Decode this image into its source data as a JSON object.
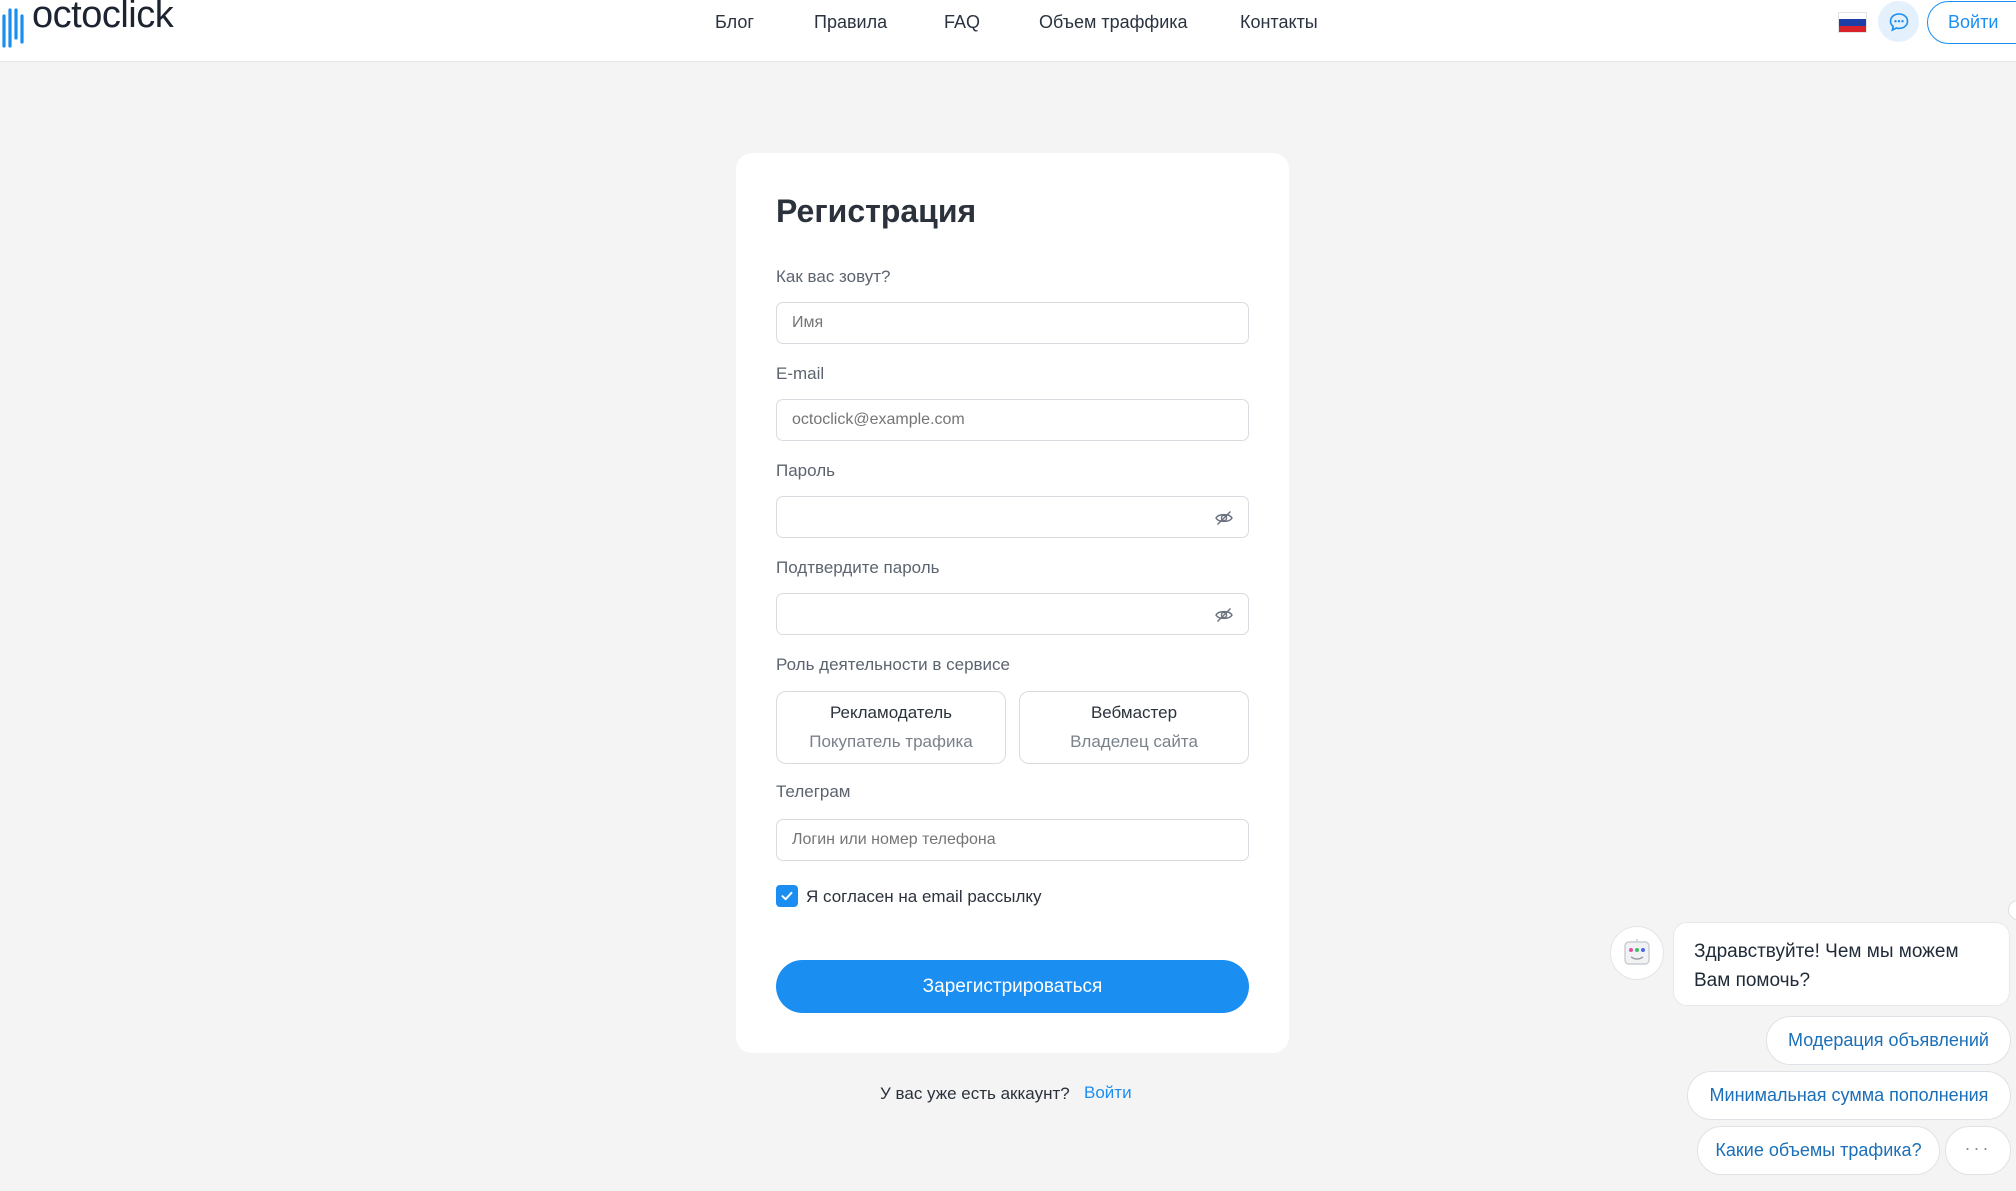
{
  "header": {
    "logo_text": "octoclick",
    "nav": [
      "Блог",
      "Правила",
      "FAQ",
      "Объем траффика",
      "Контакты"
    ],
    "login_label": "Войти",
    "flag_colors": [
      "#ffffff",
      "#1c3fa8",
      "#d8232a"
    ]
  },
  "form": {
    "title": "Регистрация",
    "name_label": "Как вас зовут?",
    "name_placeholder": "Имя",
    "email_label": "E-mail",
    "email_placeholder": "octoclick@example.com",
    "password_label": "Пароль",
    "confirm_label": "Подтвердите пароль",
    "role_label": "Роль деятельности в сервисе",
    "roles": [
      {
        "title": "Рекламодатель",
        "subtitle": "Покупатель трафика"
      },
      {
        "title": "Вебмастер",
        "subtitle": "Владелец сайта"
      }
    ],
    "telegram_label": "Телеграм",
    "telegram_placeholder": "Логин или номер телефона",
    "newsletter_label": "Я согласен на email рассылку",
    "newsletter_checked": true,
    "submit_label": "Зарегистрироваться"
  },
  "footer": {
    "have_account_text": "У вас уже есть аккаунт?",
    "login_link": "Войти"
  },
  "chat": {
    "greeting": "Здравствуйте! Чем мы можем Вам помочь?",
    "suggestions": [
      "Модерация объявлений",
      "Минимальная сумма пополнения",
      "Какие объемы трафика?"
    ],
    "more_label": "···"
  },
  "colors": {
    "accent": "#1b8ef1",
    "background": "#f4f4f4"
  }
}
